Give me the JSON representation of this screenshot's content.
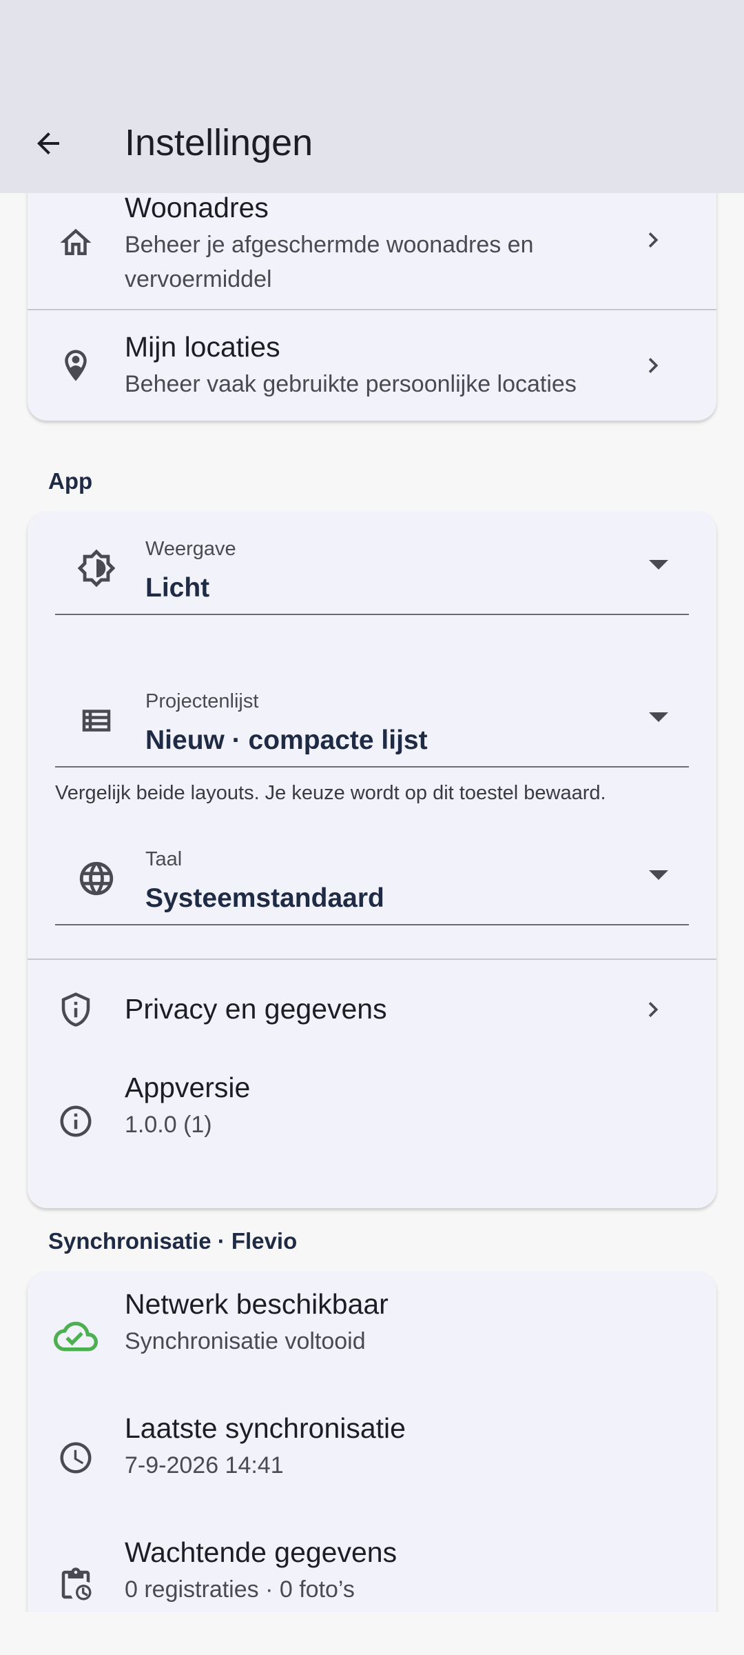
{
  "appbar": {
    "title": "Instellingen",
    "back_icon": "arrow-left-icon"
  },
  "account": {
    "items": [
      {
        "title": "Woonadres",
        "subtitle_line1": "Beheer je afgeschermde woonadres en",
        "subtitle_line2": "vervoermiddel",
        "icon": "home-icon"
      },
      {
        "title": "Mijn locaties",
        "subtitle": "Beheer vaak gebruikte persoonlijke locaties",
        "icon": "location-person-icon"
      }
    ]
  },
  "app_section": {
    "label": "App",
    "fields": {
      "weergave": {
        "label": "Weergave",
        "value": "Licht",
        "icon": "brightness-icon"
      },
      "projectenlijst": {
        "label": "Projectenlijst",
        "value": "Nieuw · compacte lijst",
        "icon": "list-icon",
        "helper": "Vergelijk beide layouts. Je keuze wordt op dit toestel bewaard."
      },
      "taal": {
        "label": "Taal",
        "value": "Systeemstandaard",
        "icon": "globe-icon"
      }
    },
    "privacy": {
      "title": "Privacy en gegevens",
      "icon": "shield-info-icon"
    },
    "appversie": {
      "title": "Appversie",
      "value": "1.0.0 (1)",
      "icon": "info-icon"
    }
  },
  "sync_section": {
    "label": "Synchronisatie · Flevio",
    "items": [
      {
        "title": "Netwerk beschikbaar",
        "subtitle": "Synchronisatie voltooid",
        "icon": "cloud-check-icon",
        "icon_color": "#4caf50"
      },
      {
        "title": "Laatste synchronisatie",
        "subtitle": "7-9-2026 14:41",
        "icon": "clock-icon"
      },
      {
        "title": "Wachtende gegevens",
        "subtitle": "0 registraties · 0 foto’s",
        "icon": "clipboard-clock-icon"
      }
    ]
  },
  "colors": {
    "appbar_bg": "#e3e3ec",
    "card_bg": "#f2f2fa",
    "page_bg": "#f7f7f7",
    "section_label": "#1f2a44",
    "success": "#4caf50"
  }
}
